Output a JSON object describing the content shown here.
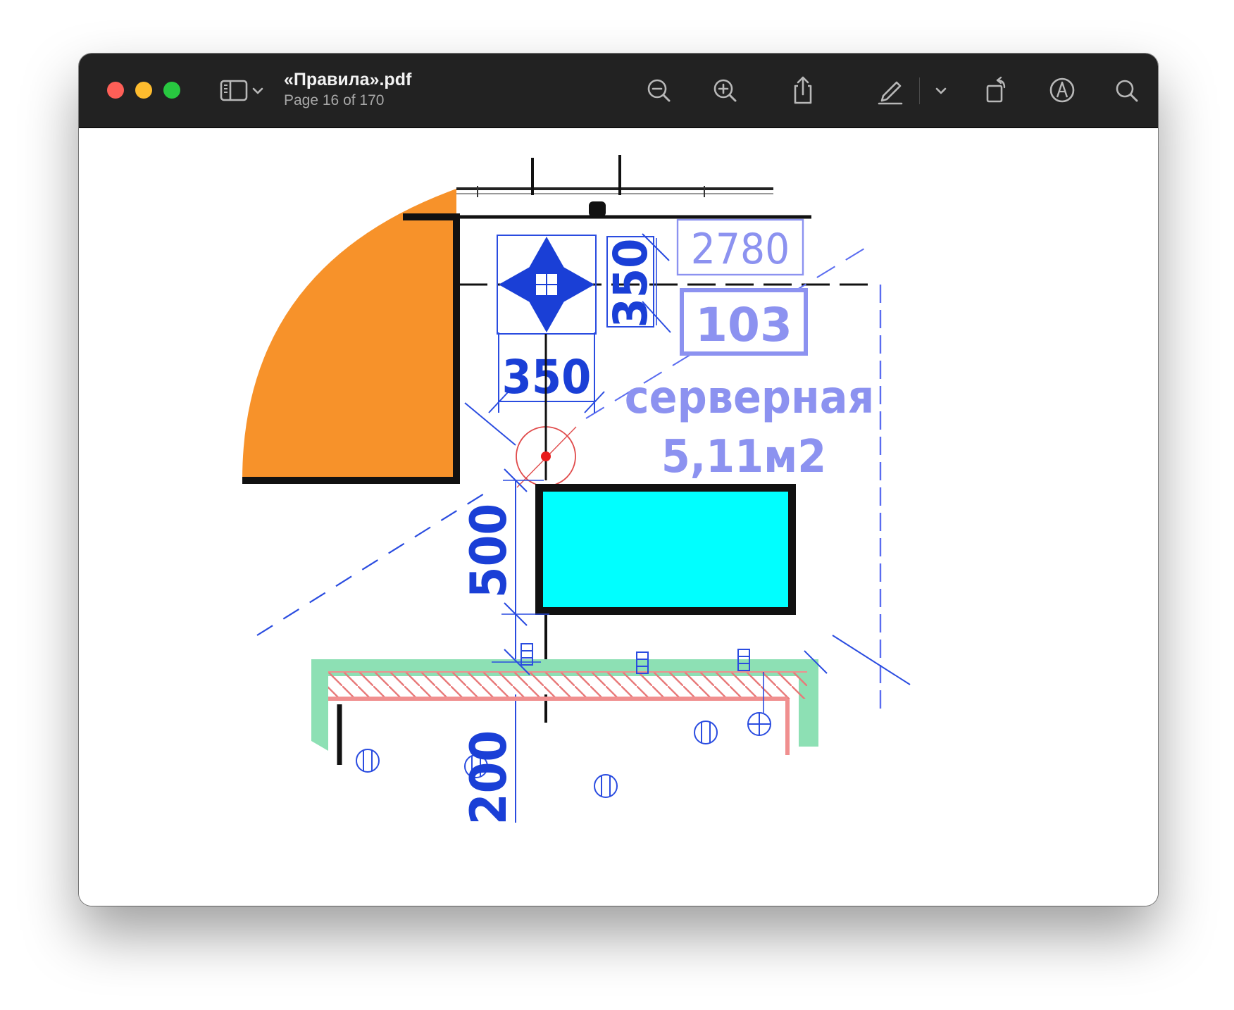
{
  "window": {
    "title": "«Правила».pdf",
    "subtitle": "Page 16 of 170"
  },
  "toolbar": {
    "buttons": [
      {
        "icon": "sidebar-icon"
      },
      {
        "icon": "chevron-down-icon"
      },
      {
        "icon": "zoom-out-icon"
      },
      {
        "icon": "zoom-in-icon"
      },
      {
        "icon": "share-icon"
      },
      {
        "icon": "highlight-pen-icon"
      },
      {
        "icon": "chevron-down-icon"
      },
      {
        "icon": "rotate-icon"
      },
      {
        "icon": "markup-icon"
      },
      {
        "icon": "search-icon"
      }
    ]
  },
  "drawing": {
    "dim_top_horizontal": "350",
    "dim_top_vertical": "350",
    "dim_left_vertical": "500",
    "dim_bottom_vertical": "200",
    "room_length": "2780",
    "room_number": "103",
    "room_name": "серверная",
    "room_area": "5,11м2"
  },
  "colors": {
    "titlebar": "#222222",
    "close": "#fe5f57",
    "minimize": "#febc2e",
    "zoom": "#28c840",
    "door": "#f7922a",
    "cabinet": "#00ffff",
    "dimension_blue": "#1a3fd6",
    "label_blue": "#8c92f0",
    "wall_green": "#8de0b4",
    "hatch_red": "#f08f8f"
  }
}
